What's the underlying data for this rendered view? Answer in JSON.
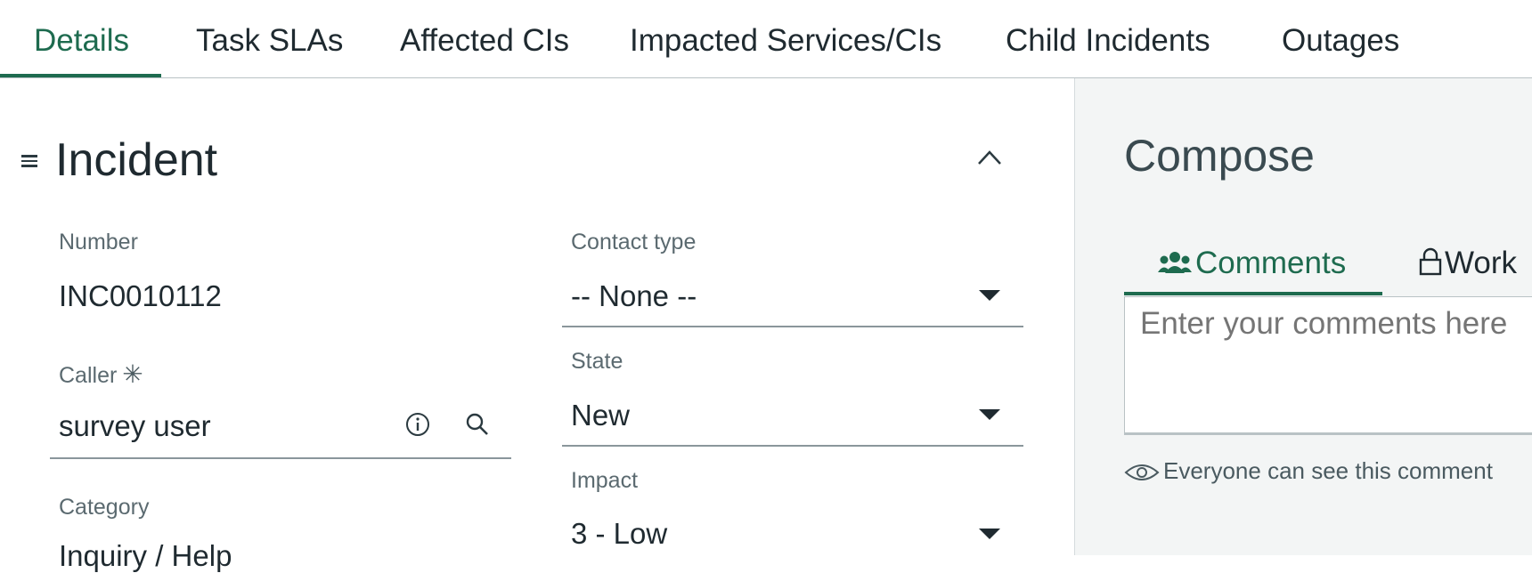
{
  "tabs": [
    {
      "label": "Details"
    },
    {
      "label": "Task SLAs"
    },
    {
      "label": "Affected CIs"
    },
    {
      "label": "Impacted Services/CIs"
    },
    {
      "label": "Child Incidents"
    },
    {
      "label": "Outages"
    }
  ],
  "section": {
    "title": "Incident"
  },
  "fields": {
    "number": {
      "label": "Number",
      "value": "INC0010112"
    },
    "caller": {
      "label": "Caller",
      "value": "survey user",
      "required_mark": "✳"
    },
    "category": {
      "label": "Category",
      "value": "Inquiry / Help"
    },
    "contact_type": {
      "label": "Contact type",
      "value": "-- None --"
    },
    "state": {
      "label": "State",
      "value": "New"
    },
    "impact": {
      "label": "Impact",
      "value": "3 - Low"
    }
  },
  "compose": {
    "title": "Compose",
    "tabs": [
      {
        "label": "Comments"
      },
      {
        "label": "Work"
      }
    ],
    "placeholder": "Enter your comments here",
    "visibility_note": "Everyone can see this comment"
  },
  "colors": {
    "accent": "#1e6b4f",
    "text": "#1f2a30",
    "muted": "#5b6a70"
  }
}
